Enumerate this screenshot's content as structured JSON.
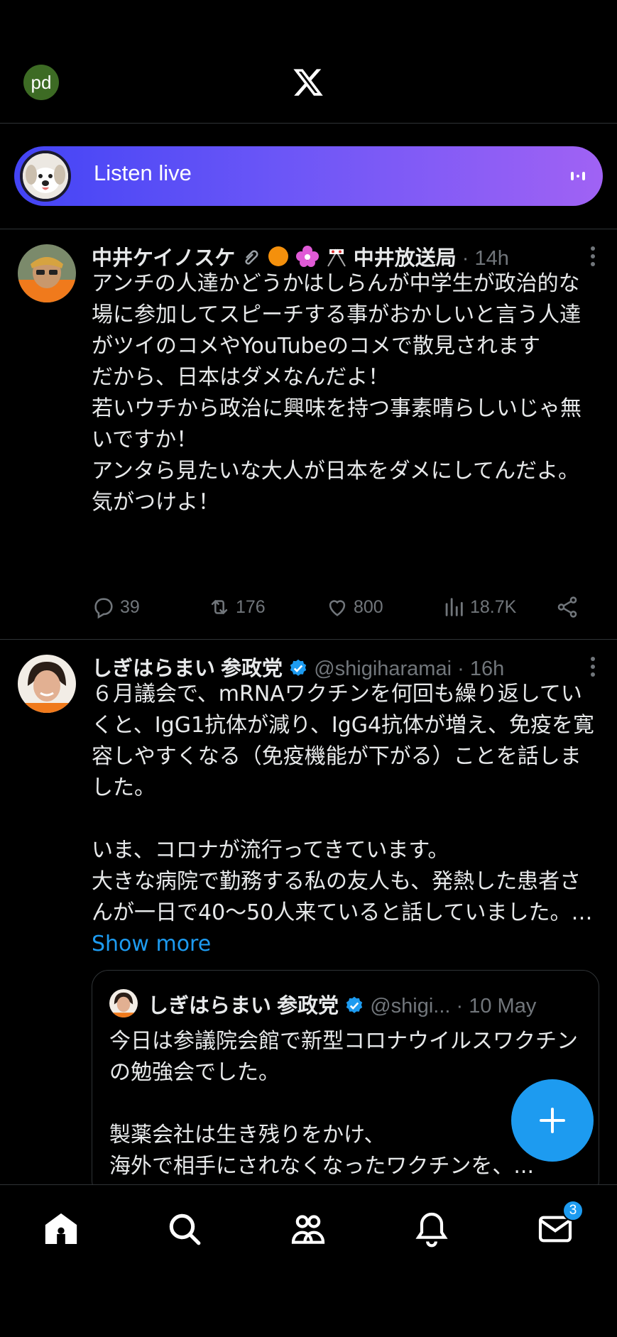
{
  "header": {
    "account_initials": "pd",
    "logo": "x-logo-icon"
  },
  "live_banner": {
    "label": "Listen live"
  },
  "tweets": [
    {
      "name": "中井ケイノスケ",
      "name_suffix": "中井放送局",
      "meta": " · 14h",
      "body": "アンチの人達かどうかはしらんが中学生が政治的な場に参加してスピーチする事がおかしいと言う人達がツイのコメやYouTubeのコメで散見されます\nだから、日本はダメなんだよ！\n若いウチから政治に興味を持つ事素晴らしいじゃ無いですか！\nアンタら見たいな大人が日本をダメにしてんだよ。\n気がつけよ！",
      "replies": "39",
      "reposts": "176",
      "likes": "800",
      "views": "18.7K"
    },
    {
      "name": "しぎはらまい 参政党",
      "handle": " @shigiharamai",
      "meta": " · 16h",
      "body": "６月議会で、mRNAワクチンを何回も繰り返していくと、IgG1抗体が減り、IgG4抗体が増え、免疫を寛容しやすくなる（免疫機能が下がる）ことを話しました。\n\nいま、コロナが流行ってきています。\n大きな病院で勤務する私の友人も、発熱した患者さんが一日で40〜50人来ていると話していました。… ",
      "show_more": "Show more",
      "quote": {
        "name": "しぎはらまい 参政党",
        "handle": " @shigi...",
        "meta": " · 10 May",
        "body": "今日は参議院会館で新型コロナウイルスワクチンの勉強会でした。\n\n製薬会社は生き残りをかけ、\n海外で相手にされなくなったワクチンを、..."
      }
    }
  ],
  "bottom_nav": {
    "items": [
      "home-icon",
      "search-icon",
      "communities-icon",
      "notifications-icon",
      "messages-icon"
    ],
    "messages_badge": "3"
  },
  "colors": {
    "accent": "#1d9bf0",
    "background": "#000000",
    "muted": "#71767b"
  }
}
